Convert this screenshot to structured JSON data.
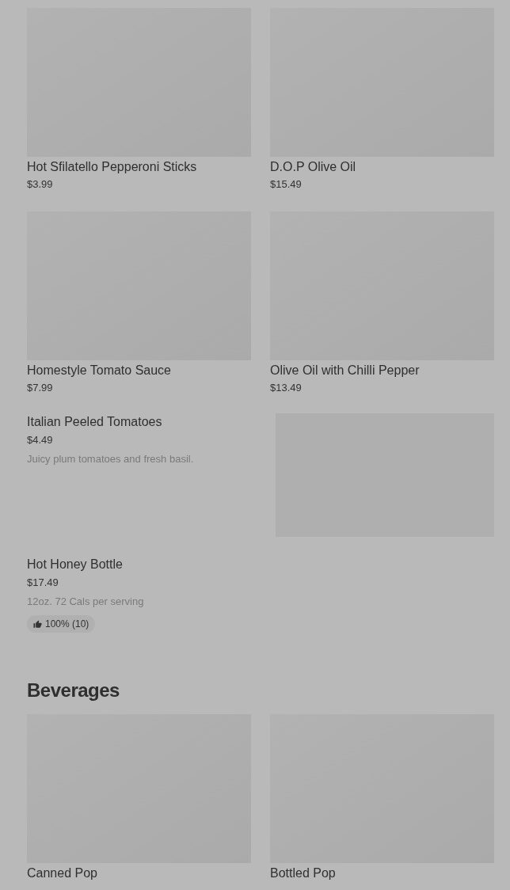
{
  "sections": [
    {
      "items": [
        {
          "kind": "tile",
          "name": "Hot Sfilatello Pepperoni Sticks",
          "price": "$3.99"
        },
        {
          "kind": "tile",
          "name": "D.O.P Olive Oil",
          "price": "$15.49"
        },
        {
          "kind": "tile",
          "name": "Homestyle Tomato Sauce",
          "price": "$7.99"
        },
        {
          "kind": "tile",
          "name": "Olive Oil with Chilli Pepper",
          "price": "$13.49"
        },
        {
          "kind": "row",
          "name": "Italian Peeled Tomatoes",
          "price": "$4.49",
          "description": "Juicy plum tomatoes and fresh basil.",
          "image": true
        },
        {
          "kind": "row",
          "name": "Hot Honey Bottle",
          "price": "$17.49",
          "description": "12oz. 72 Cals per serving",
          "rating": "100% (10)",
          "image": false
        }
      ]
    },
    {
      "title": "Beverages",
      "items": [
        {
          "kind": "tile",
          "name": "Canned Pop"
        },
        {
          "kind": "tile",
          "name": "Bottled Pop"
        }
      ]
    }
  ]
}
